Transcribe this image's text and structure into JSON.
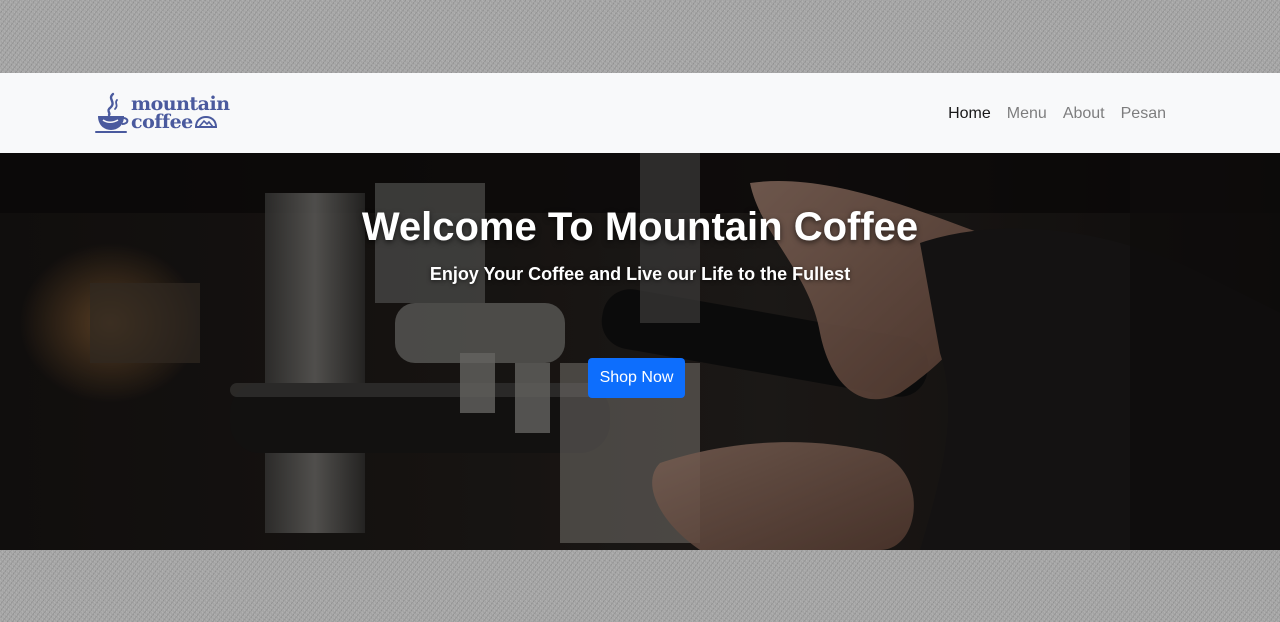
{
  "brand": {
    "line1": "mountain",
    "line2": "coffee",
    "color": "#4a5a9e"
  },
  "nav": {
    "items": [
      {
        "label": "Home",
        "active": true
      },
      {
        "label": "Menu",
        "active": false
      },
      {
        "label": "About",
        "active": false
      },
      {
        "label": "Pesan",
        "active": false
      }
    ]
  },
  "hero": {
    "title": "Welcome To Mountain Coffee",
    "subtitle": "Enjoy Your Coffee and Live our Life to the Fullest",
    "button_label": "Shop Now",
    "button_color": "#0d6efd",
    "background_image": "barista-espresso-machine-photo"
  },
  "colors": {
    "navbar_bg": "#f8f9fa",
    "page_backdrop": "#a3a3a3"
  }
}
